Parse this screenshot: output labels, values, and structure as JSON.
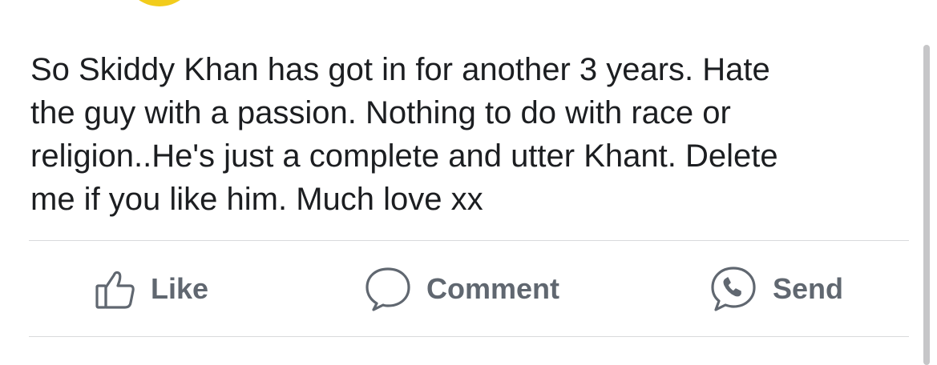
{
  "post": {
    "text": "So Skiddy Khan has got in for another 3 years. Hate\nthe guy with a passion. Nothing to do with race or\nreligion..He's just a complete and utter Khant. Delete\nme if you like him. Much love xx"
  },
  "actions": {
    "like": {
      "label": "Like",
      "icon": "thumbs-up-icon"
    },
    "comment": {
      "label": "Comment",
      "icon": "speech-bubble-icon"
    },
    "send": {
      "label": "Send",
      "icon": "messenger-phone-icon"
    }
  },
  "colors": {
    "text": "#1c1e21",
    "action_gray": "#606770",
    "divider": "#d9dadc",
    "avatar": "#f2cc1c",
    "scrollbar": "#c6c6c8"
  }
}
